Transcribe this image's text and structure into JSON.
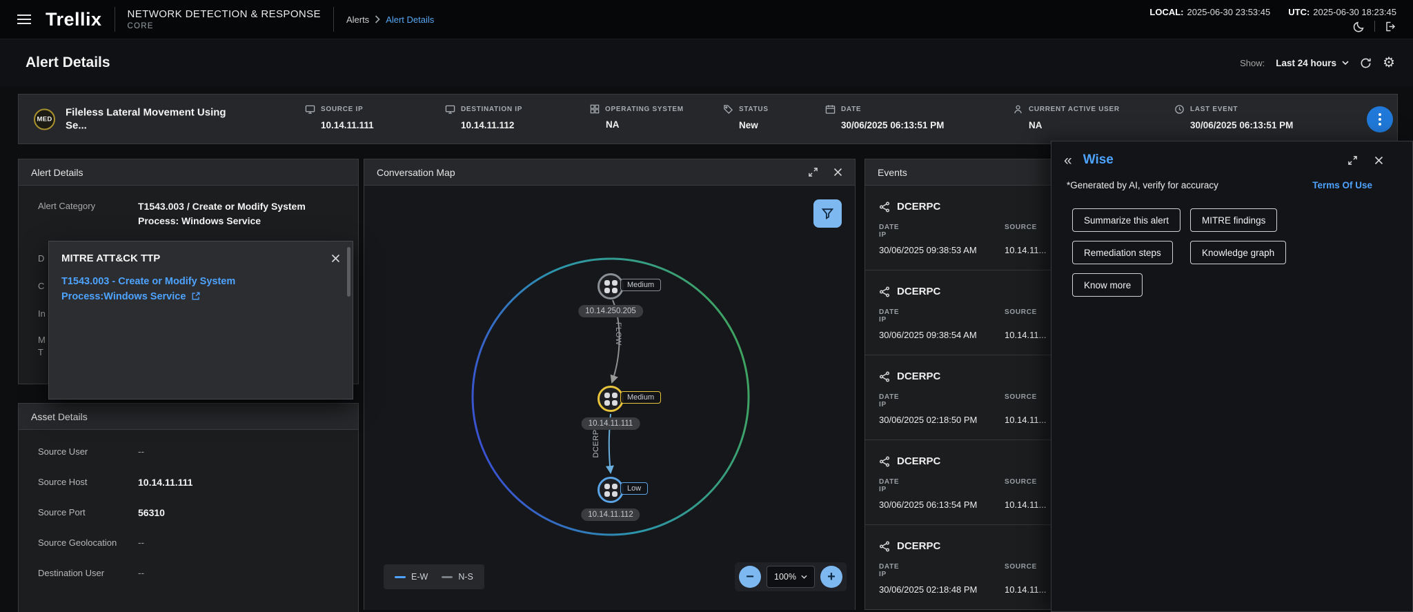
{
  "header": {
    "brand": "Trellix",
    "product": "NETWORK DETECTION & RESPONSE",
    "product_sub": "CORE",
    "breadcrumb_parent": "Alerts",
    "breadcrumb_current": "Alert Details",
    "local_label": "LOCAL:",
    "local_time": "2025-06-30 23:53:45",
    "utc_label": "UTC:",
    "utc_time": "2025-06-30 18:23:45"
  },
  "titlebar": {
    "title": "Alert Details",
    "show_label": "Show:",
    "range": "Last 24 hours"
  },
  "summary": {
    "severity": "MED",
    "alert_title": "Fileless Lateral Movement Using Se...",
    "fields": [
      {
        "label": "SOURCE IP",
        "value": "10.14.11.111",
        "icon": "source-ip-icon"
      },
      {
        "label": "DESTINATION IP",
        "value": "10.14.11.112",
        "icon": "destination-ip-icon"
      },
      {
        "label": "OPERATING SYSTEM",
        "value": "NA",
        "icon": "os-icon"
      },
      {
        "label": "STATUS",
        "value": "New",
        "icon": "status-tag-icon"
      },
      {
        "label": "DATE",
        "value": "30/06/2025 06:13:51 PM",
        "icon": "calendar-icon"
      },
      {
        "label": "CURRENT ACTIVE USER",
        "value": "NA",
        "icon": "user-icon"
      },
      {
        "label": "LAST EVENT",
        "value": "30/06/2025 06:13:51 PM",
        "icon": "clock-icon"
      }
    ]
  },
  "alert_details": {
    "title": "Alert Details",
    "category_label": "Alert Category",
    "category_value": "T1543.003 / Create or Modify System Process: Windows Service",
    "obscured_labels": {
      "0": "D",
      "1": "C",
      "2": "In",
      "3": "M",
      "4": "T"
    }
  },
  "mitre_popup": {
    "title": "MITRE ATT&CK TTP",
    "link": "T1543.003 - Create or Modify System Process:Windows Service"
  },
  "asset_details": {
    "title": "Asset Details",
    "rows": [
      {
        "label": "Source User",
        "value": "--"
      },
      {
        "label": "Source Host",
        "value": "10.14.11.111"
      },
      {
        "label": "Source Port",
        "value": "56310"
      },
      {
        "label": "Source Geolocation",
        "value": "--"
      },
      {
        "label": "Destination User",
        "value": "--"
      }
    ]
  },
  "map": {
    "title": "Conversation Map",
    "nodes": [
      {
        "ip": "10.14.250.205",
        "severity": "Medium",
        "color": "#8a8f96"
      },
      {
        "ip": "10.14.11.111",
        "severity": "Medium",
        "color": "#e8c33c"
      },
      {
        "ip": "10.14.11.112",
        "severity": "Low",
        "color": "#5aa4e6"
      }
    ],
    "edges": [
      {
        "label": "FLOW"
      },
      {
        "label": "DCERPC"
      }
    ],
    "legend": [
      {
        "label": "E-W",
        "color": "#4da3ff"
      },
      {
        "label": "N-S",
        "color": "#7a7f85"
      }
    ],
    "zoom": "100%"
  },
  "events": {
    "title": "Events",
    "date_label": "DATE",
    "source_label": "SOURCE IP",
    "items": [
      {
        "protocol": "DCERPC",
        "date": "30/06/2025 09:38:53 AM",
        "source_ip": "10.14.11..."
      },
      {
        "protocol": "DCERPC",
        "date": "30/06/2025 09:38:54 AM",
        "source_ip": "10.14.11..."
      },
      {
        "protocol": "DCERPC",
        "date": "30/06/2025 02:18:50 PM",
        "source_ip": "10.14.11..."
      },
      {
        "protocol": "DCERPC",
        "date": "30/06/2025 06:13:54 PM",
        "source_ip": "10.14.11..."
      },
      {
        "protocol": "DCERPC",
        "date": "30/06/2025 02:18:48 PM",
        "source_ip": "10.14.11..."
      }
    ]
  },
  "wise": {
    "title": "Wise",
    "disclaimer": "*Generated by AI, verify for accuracy",
    "terms": "Terms Of Use",
    "buttons": [
      "Summarize this alert",
      "MITRE findings",
      "Remediation steps",
      "Knowledge graph",
      "Know more"
    ]
  },
  "colors": {
    "accent_blue": "#4da3ff",
    "control_blue": "#7db9f0",
    "severity_medium_ring": "#a8922f",
    "node_medium": "#e8c33c",
    "node_low": "#5aa4e6",
    "node_neutral": "#8a8f96"
  }
}
